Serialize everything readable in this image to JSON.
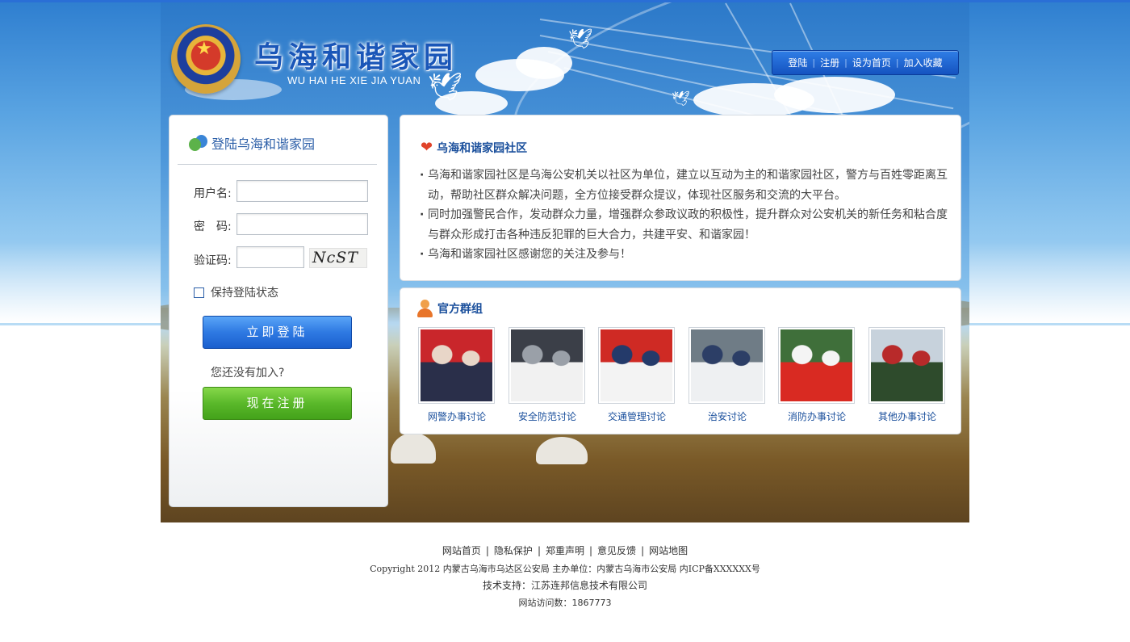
{
  "header": {
    "title": "乌海和谐家园",
    "subtitle": "WU HAI HE XIE JIA YUAN",
    "nav": [
      "登陆",
      "注册",
      "设为首页",
      "加入收藏"
    ]
  },
  "login": {
    "title": "登陆乌海和谐家园",
    "username_label": "用户名:",
    "password_label": "密　码:",
    "captcha_label": "验证码:",
    "captcha_text": "NcST",
    "remember_label": "保持登陆状态",
    "login_button": "立即登陆",
    "join_prompt": "您还没有加入?",
    "register_button": "现在注册"
  },
  "intro": {
    "title": "乌海和谐家园社区",
    "paragraphs": [
      "乌海和谐家园社区是乌海公安机关以社区为单位，建立以互动为主的和谐家园社区，警方与百姓零距离互动，帮助社区群众解决问题，全方位接受群众提议，体现社区服务和交流的大平台。",
      "同时加强警民合作，发动群众力量，增强群众参政议政的积极性，提升群众对公安机关的新任务和粘合度与群众形成打击各种违反犯罪的巨大合力，共建平安、和谐家园！",
      "乌海和谐家园社区感谢您的关注及参与！"
    ]
  },
  "groups": {
    "title": "官方群组",
    "items": [
      {
        "label": "网警办事讨论",
        "palette": [
          "#c9262b",
          "#2a2f4a",
          "#e8d6c8"
        ]
      },
      {
        "label": "安全防范讨论",
        "palette": [
          "#3b3f48",
          "#f1f1f1",
          "#9aa0a8"
        ]
      },
      {
        "label": "交通管理讨论",
        "palette": [
          "#cf2a24",
          "#f3f3f3",
          "#243a6a"
        ]
      },
      {
        "label": "治安讨论",
        "palette": [
          "#6f7c86",
          "#eef0f2",
          "#2c3e66"
        ]
      },
      {
        "label": "消防办事讨论",
        "palette": [
          "#3f6f3a",
          "#d92a22",
          "#f4f4f4"
        ]
      },
      {
        "label": "其他办事讨论",
        "palette": [
          "#c7d2dc",
          "#2e4b2c",
          "#b82a2a"
        ]
      }
    ]
  },
  "footer": {
    "links": [
      "网站首页",
      "隐私保护",
      "郑重声明",
      "意见反馈",
      "网站地图"
    ],
    "copyright": "Copyright 2012 内蒙古乌海市乌达区公安局 主办单位：内蒙古乌海市公安局 内ICP备XXXXXX号",
    "support": "技术支持：江苏连邦信息技术有限公司",
    "visits": "网站访问数：1867773"
  }
}
